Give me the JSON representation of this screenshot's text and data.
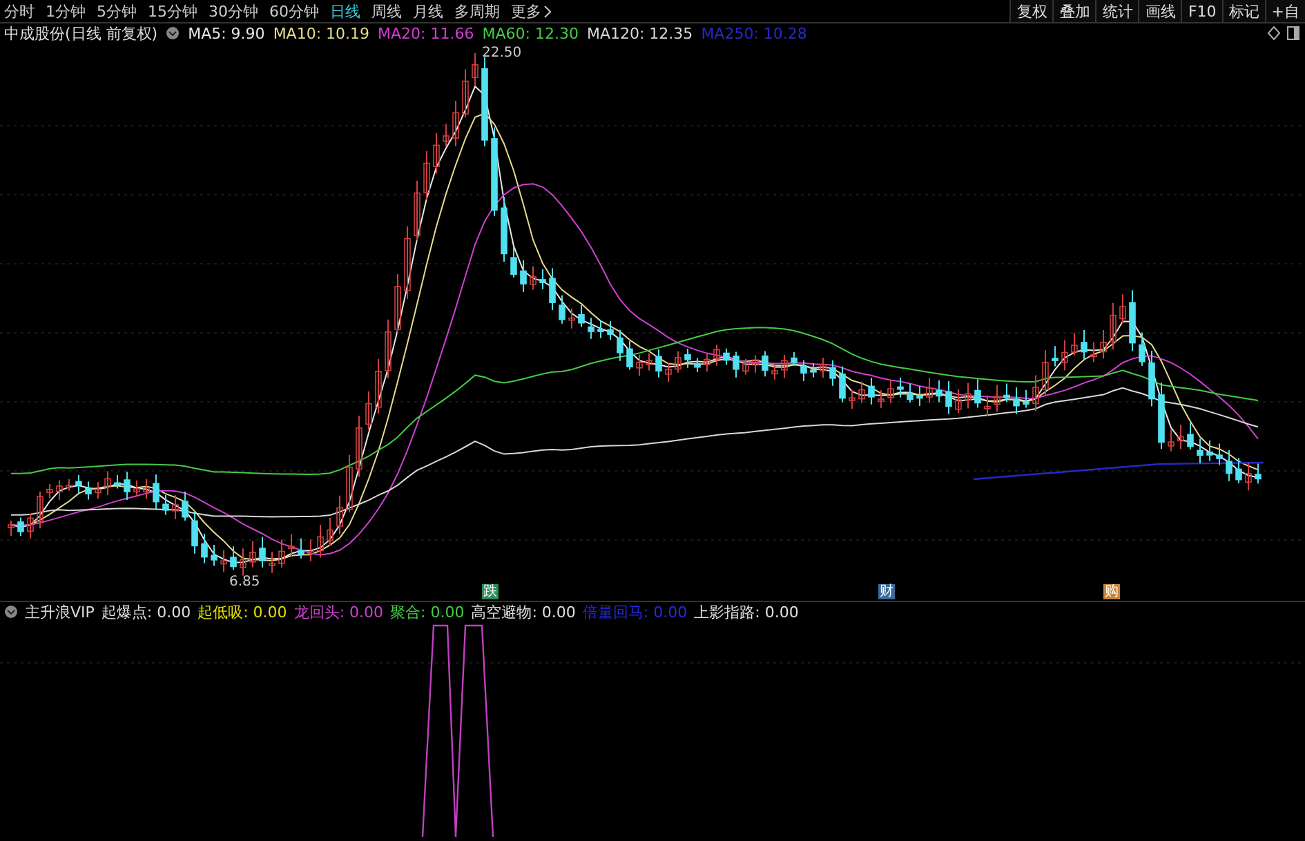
{
  "periods": [
    {
      "label": "分时",
      "selected": false
    },
    {
      "label": "1分钟",
      "selected": false
    },
    {
      "label": "5分钟",
      "selected": false
    },
    {
      "label": "15分钟",
      "selected": false
    },
    {
      "label": "30分钟",
      "selected": false
    },
    {
      "label": "60分钟",
      "selected": false
    },
    {
      "label": "日线",
      "selected": true
    },
    {
      "label": "周线",
      "selected": false
    },
    {
      "label": "月线",
      "selected": false
    },
    {
      "label": "多周期",
      "selected": false
    },
    {
      "label": "更多",
      "selected": false
    }
  ],
  "tools": [
    "复权",
    "叠加",
    "统计",
    "画线",
    "F10",
    "标记",
    "+自"
  ],
  "title": "中成股份(日线 前复权)",
  "ma_legend": [
    {
      "label": "MA5: 9.90",
      "color": "#e8e8e8"
    },
    {
      "label": "MA10: 10.19",
      "color": "#e6dc8c"
    },
    {
      "label": "MA20: 11.66",
      "color": "#d040d0"
    },
    {
      "label": "MA60: 12.30",
      "color": "#44cc44"
    },
    {
      "label": "MA120: 12.35",
      "color": "#d8d8d8"
    },
    {
      "label": "MA250: 10.28",
      "color": "#2828c8"
    }
  ],
  "price_labels": [
    {
      "text": "22.50",
      "kind": "high"
    },
    {
      "text": "6.85",
      "kind": "low"
    }
  ],
  "signals": [
    {
      "text": "跌",
      "color": "#2e8b57"
    },
    {
      "text": "财",
      "color": "#3a6a9a"
    },
    {
      "text": "购",
      "color": "#c8843c"
    }
  ],
  "indicator": {
    "name": "主升浪VIP",
    "values": [
      {
        "label": "起爆点: 0.00",
        "color": "#e0e0e0"
      },
      {
        "label": "起低吸: 0.00",
        "color": "#e0e000"
      },
      {
        "label": "龙回头: 0.00",
        "color": "#d040d0"
      },
      {
        "label": "聚合: 0.00",
        "color": "#44cc44"
      },
      {
        "label": "高空避物: 0.00",
        "color": "#e0e0e0"
      },
      {
        "label": "倍量回马: 0.00",
        "color": "#2828e0"
      },
      {
        "label": "上影指路: 0.00",
        "color": "#e0e0e0"
      }
    ]
  }
}
